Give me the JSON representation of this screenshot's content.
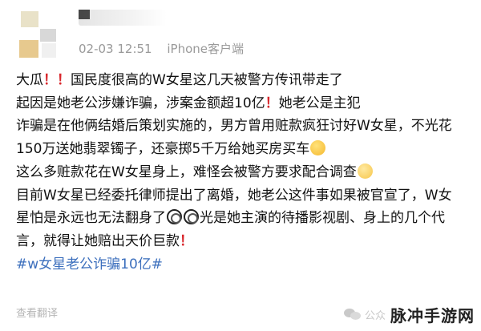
{
  "post": {
    "date": "02-03 12:51",
    "device": "iPhone客户端"
  },
  "lines": [
    [
      "大瓜",
      "！",
      "",
      "！",
      "国民度很高的W女星这几天被警方传讯带走了"
    ],
    [
      "起因是她老公涉嫌诈骗，涉案金额超10亿",
      "！",
      "她老公是主犯"
    ],
    [
      "诈骗是在他俩结婚后策划实施的，男方曾用赃款疯狂讨好W女星，不光花"
    ],
    [
      "150万送她翡翠镯子，还豪掷5千万给她买房买车"
    ],
    [
      "这么多赃款花在W女星身上，难怪会被警方要求配合调查"
    ],
    [
      "目前W女星已经委托律师提出了离婚，她老公这件事如果被官宣了，W女"
    ],
    [
      "星怕是永远也无法翻身了",
      "光是她主演的待播影视剧、身上的几个代"
    ],
    [
      "言，就得让她赔出天价巨款",
      "！"
    ]
  ],
  "hashtag": "#w女星老公诈骗10亿#",
  "translate_label": "查看翻译",
  "watermark": {
    "faded": "公众",
    "text": "脉冲手游网"
  },
  "emojis": [
    "smug-face",
    "shushing-face",
    "dizzy-face",
    "dizzy-face"
  ],
  "colors": {
    "exclamation": "#d8262b",
    "hashtag": "#3c6fbd",
    "meta": "#9a9a9a"
  }
}
